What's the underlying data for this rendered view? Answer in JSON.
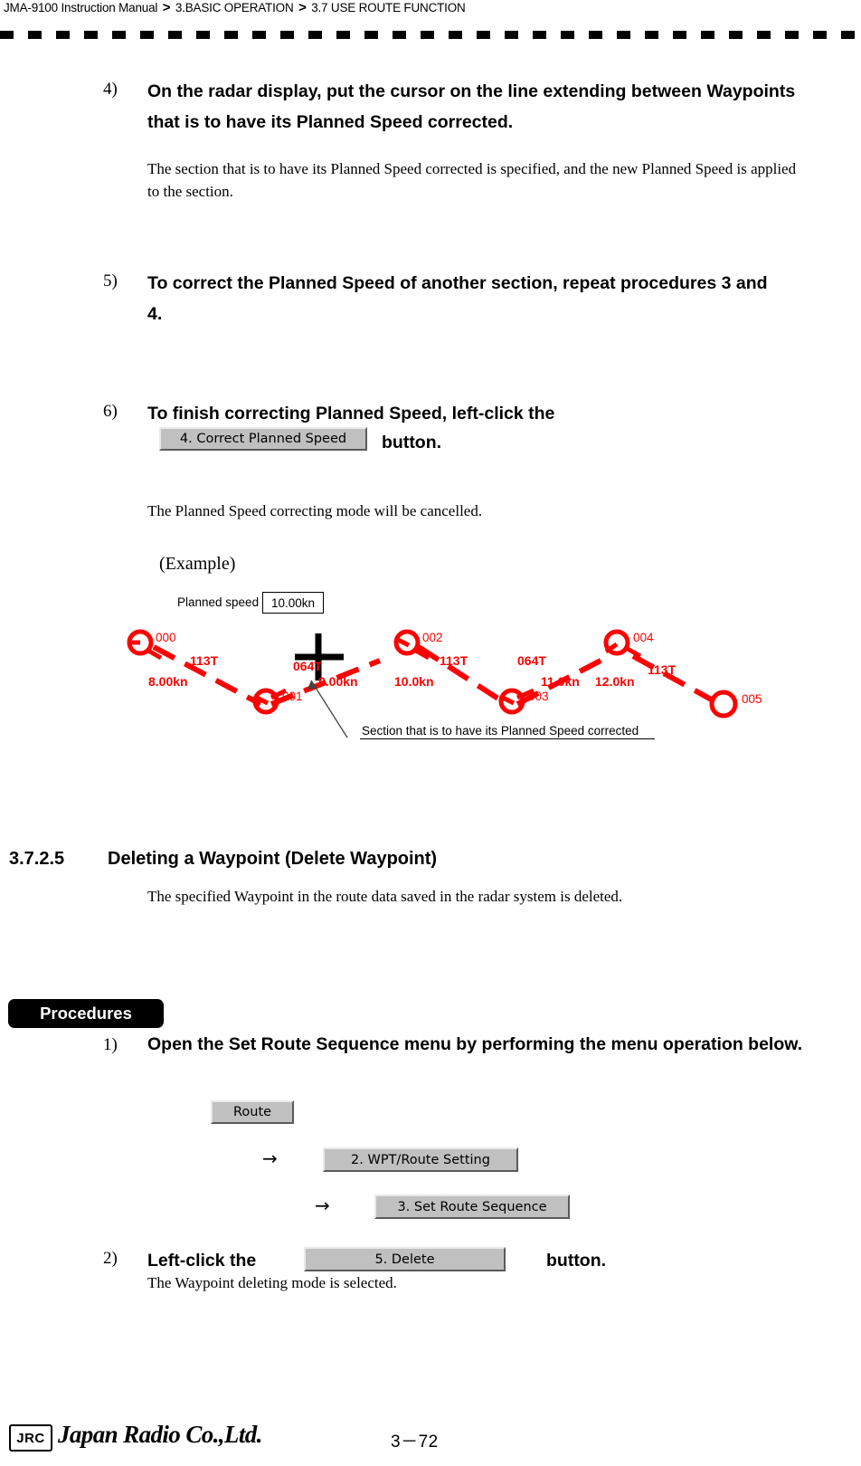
{
  "header": {
    "manual": "JMA-9100 Instruction Manual",
    "chapter": "3.BASIC OPERATION",
    "section": "3.7  USE ROUTE FUNCTION",
    "separator": ">"
  },
  "steps": [
    {
      "number": "4)",
      "heading": "On the radar display, put the cursor on the line extending between Waypoints that is to have its Planned Speed corrected.",
      "body": "The section that is to have its Planned Speed corrected is specified, and the new Planned Speed is applied to the section."
    },
    {
      "number": "5)",
      "heading": "To correct the Planned Speed of another section, repeat procedures 3 and 4.",
      "body": ""
    },
    {
      "number": "6)",
      "heading_part1": "To finish correcting Planned Speed, left-click the",
      "button_label": "4. Correct Planned Speed",
      "heading_part2": "button.",
      "body": "The Planned Speed correcting mode will be cancelled."
    }
  ],
  "figure": {
    "example_label": "(Example)",
    "planned_speed_label": "Planned speed",
    "planned_speed_value": "10.00kn",
    "caption": "Section that is to have its Planned Speed corrected",
    "waypoints": [
      "000",
      "001",
      "002",
      "003",
      "004",
      "005"
    ],
    "legs": [
      {
        "course": "113T",
        "speed": "8.00kn"
      },
      {
        "course": "064T",
        "speed": "9.00kn"
      },
      {
        "course": "113T",
        "speed": "10.0kn"
      },
      {
        "course": "064T",
        "speed": "11.0kn"
      },
      {
        "course": "113T",
        "speed": "12.0kn"
      }
    ],
    "marker_color": "#ff0000"
  },
  "section": {
    "number": "3.7.2.5",
    "title": "Deleting a Waypoint (Delete Waypoint)",
    "intro": "The specified Waypoint in the route data saved in the radar system is deleted."
  },
  "procedures": {
    "tag": "Procedures",
    "step1": {
      "number": "1)",
      "heading": "Open the Set Route Sequence menu by performing the menu operation below.",
      "menu_path": [
        {
          "label": "Route",
          "arrow": ""
        },
        {
          "label": "2. WPT/Route Setting",
          "arrow": "→"
        },
        {
          "label": "3. Set Route Sequence",
          "arrow": "→"
        }
      ]
    },
    "step2": {
      "number": "2)",
      "heading_part1": "Left-click the",
      "button_label": "5. Delete",
      "heading_part2": "button.",
      "body": "The Waypoint deleting mode is selected."
    }
  },
  "footer": {
    "logo": "JRC",
    "company": "Japan Radio Co.,Ltd.",
    "page": "3－72"
  }
}
